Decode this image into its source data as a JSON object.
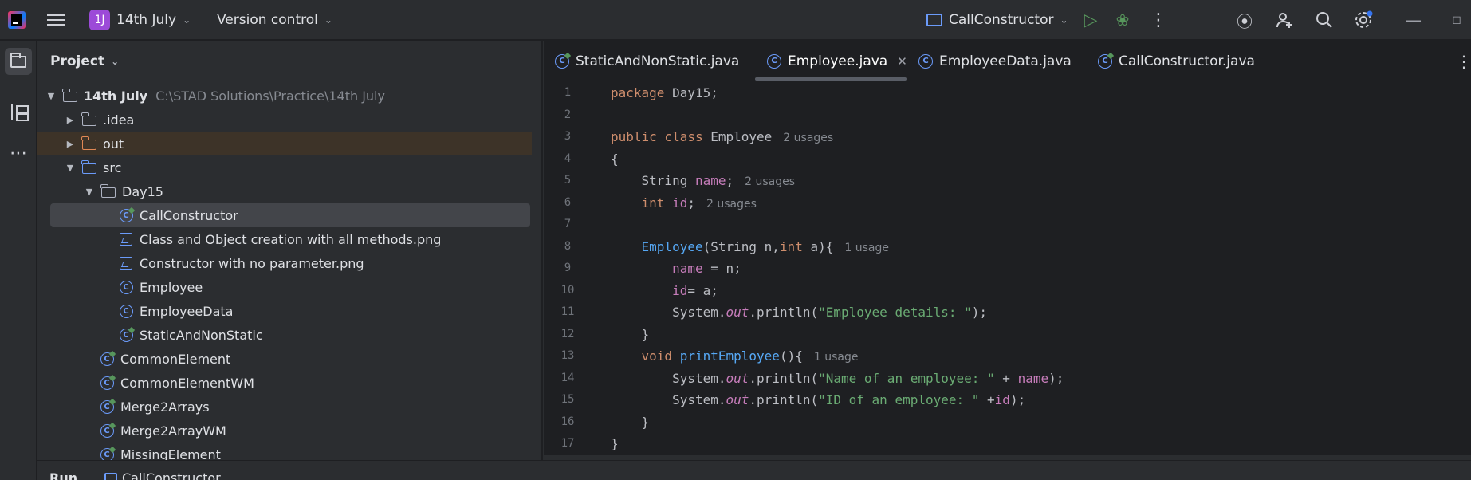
{
  "titlebar": {
    "project_badge": "1J",
    "project_name": "14th July",
    "vcs_label": "Version control",
    "run_config": "CallConstructor"
  },
  "project_panel": {
    "header": "Project",
    "tree": [
      {
        "label": "14th July",
        "path": "C:\\STAD Solutions\\Practice\\14th July"
      },
      {
        "label": ".idea"
      },
      {
        "label": "out"
      },
      {
        "label": "src"
      },
      {
        "label": "Day15"
      },
      {
        "label": "CallConstructor"
      },
      {
        "label": "Class and Object creation with all methods.png"
      },
      {
        "label": "Constructor with no parameter.png"
      },
      {
        "label": "Employee"
      },
      {
        "label": "EmployeeData"
      },
      {
        "label": "StaticAndNonStatic"
      },
      {
        "label": "CommonElement"
      },
      {
        "label": "CommonElementWM"
      },
      {
        "label": "Merge2Arrays"
      },
      {
        "label": "Merge2ArrayWM"
      },
      {
        "label": "MissingElement"
      }
    ]
  },
  "editor": {
    "tabs": [
      {
        "label": "StaticAndNonStatic.java"
      },
      {
        "label": "Employee.java"
      },
      {
        "label": "EmployeeData.java"
      },
      {
        "label": "CallConstructor.java"
      }
    ],
    "line_numbers": [
      "1",
      "2",
      "3",
      "4",
      "5",
      "6",
      "7",
      "8",
      "9",
      "10",
      "11",
      "12",
      "13",
      "14",
      "15",
      "16",
      "17"
    ],
    "code": {
      "l1_kw": "package",
      "l1_rest": " Day15;",
      "l3_kw": "public class",
      "l3_name": " Employee",
      "l3_hint": "2 usages",
      "l4": "{",
      "l5_type": "    String ",
      "l5_field": "name",
      "l5_semi": ";",
      "l5_hint": "2 usages",
      "l6_kw": "    int ",
      "l6_field": "id",
      "l6_semi": ";",
      "l6_hint": "2 usages",
      "l8_fn": "    Employee",
      "l8_a": "(String n,",
      "l8_kw": "int",
      "l8_b": " a){",
      "l8_hint": "1 usage",
      "l9_field": "        name",
      "l9_rest": " = n;",
      "l10_field": "        id",
      "l10_rest": "= a;",
      "l11_a": "        System.",
      "l11_out": "out",
      "l11_b": ".println(",
      "l11_str": "\"Employee details: \"",
      "l11_c": ");",
      "l12": "    }",
      "l13_kw": "    void ",
      "l13_fn": "printEmployee",
      "l13_rest": "(){",
      "l13_hint": "1 usage",
      "l14_a": "        System.",
      "l14_out": "out",
      "l14_b": ".println(",
      "l14_str": "\"Name of an employee: \"",
      "l14_c": " + ",
      "l14_field": "name",
      "l14_d": ");",
      "l15_a": "        System.",
      "l15_out": "out",
      "l15_b": ".println(",
      "l15_str": "\"ID of an employee: \"",
      "l15_c": " +",
      "l15_field": "id",
      "l15_d": ");",
      "l16": "    }",
      "l17": "}"
    }
  },
  "bottombar": {
    "run_label": "Run",
    "run_tab": "CallConstructor"
  },
  "colors": {
    "keyword": "#cf8e6d",
    "field": "#c77dbb",
    "string": "#6aab73",
    "function": "#56a8f5",
    "accent": "#6b9bfa"
  }
}
